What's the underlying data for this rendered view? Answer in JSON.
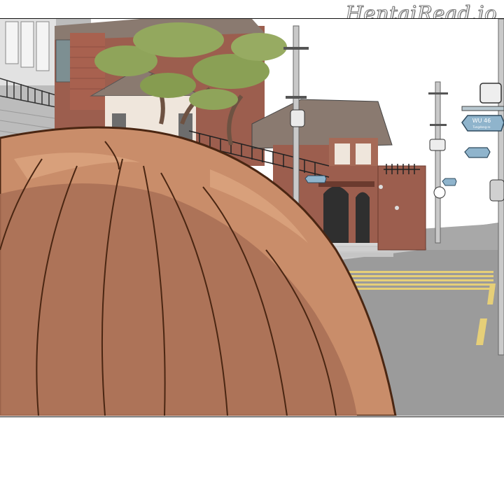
{
  "watermark": {
    "text": "HentaiRead.io"
  },
  "scene": {
    "street_sign_text": "WU 46",
    "street_sign_subtext": "Tungdong-ro",
    "colors": {
      "hair_base": "#c98d6a",
      "hair_shadow": "#a86f55",
      "hair_highlight": "#d8a07b",
      "hair_outline": "#4a2612",
      "brick": "#9c5e4e",
      "brick_dark": "#7e463a",
      "roof": "#8a7a70",
      "road": "#9a9a9a",
      "road_marking": "#e8d27a",
      "sign_blue": "#8fb4cc",
      "tree_green": "#8fa45a",
      "panel_border": "#111111"
    }
  }
}
